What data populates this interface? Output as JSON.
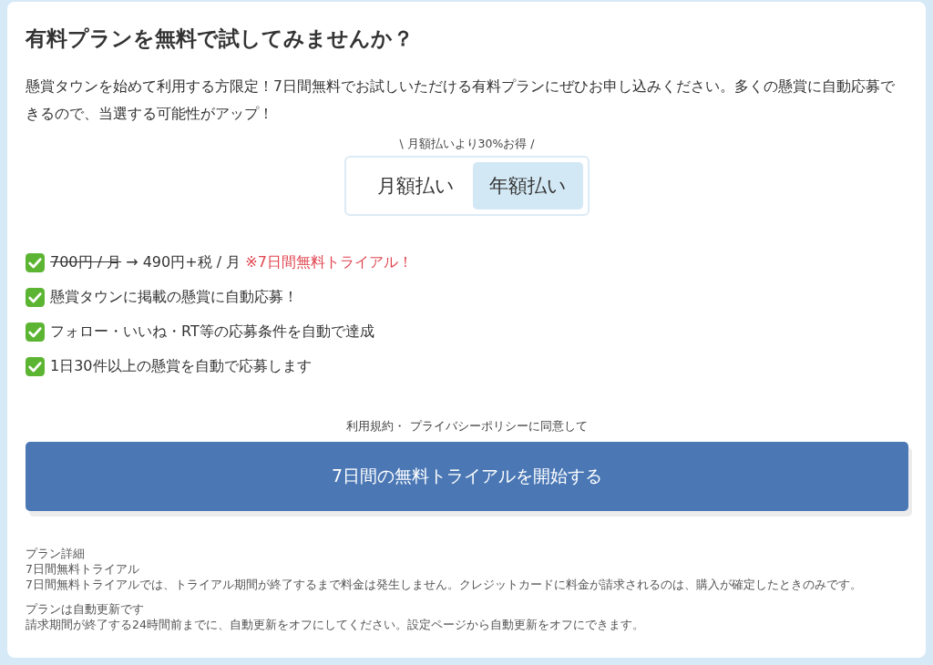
{
  "title": "有料プランを無料で試してみませんか？",
  "intro": "懸賞タウンを始めて利用する方限定！7日間無料でお試しいただける有料プランにぜひお申し込みください。多くの懸賞に自動応募できるので、当選する可能性がアップ！",
  "billing": {
    "note": "\\ 月額払いより30%お得 /",
    "options": [
      {
        "label": "月額払い",
        "selected": false
      },
      {
        "label": "年額払い",
        "selected": true
      }
    ]
  },
  "features": [
    {
      "parts": [
        {
          "kind": "strike",
          "text": "700円 / 月"
        },
        {
          "kind": "plain",
          "text": " → 490円+税 / 月 "
        },
        {
          "kind": "notice",
          "text": "※7日間無料トライアル！"
        }
      ]
    },
    {
      "parts": [
        {
          "kind": "plain",
          "text": "懸賞タウンに掲載の懸賞に自動応募！"
        }
      ]
    },
    {
      "parts": [
        {
          "kind": "plain",
          "text": "フォロー・いいね・RT等の応募条件を自動で達成"
        }
      ]
    },
    {
      "parts": [
        {
          "kind": "plain",
          "text": "1日30件以上の懸賞を自動で応募します"
        }
      ]
    }
  ],
  "agreement": "利用規約・ プライバシーポリシーに同意して",
  "start_button": "7日間の無料トライアルを開始する",
  "details": [
    {
      "kind": "heading",
      "text": " プラン詳細"
    },
    {
      "kind": "line",
      "text": "7日間無料トライアル"
    },
    {
      "kind": "line",
      "text": "7日間無料トライアルでは、トライアル期間が終了するまで料金は発生しません。クレジットカードに料金が請求されるのは、購入が確定したときのみです。"
    },
    {
      "kind": "gap-line",
      "text": "プランは自動更新です"
    },
    {
      "kind": "line",
      "text": "請求期間が終了する24時間前までに、自動更新をオフにしてください。設定ページから自動更新をオフにできます。"
    }
  ]
}
